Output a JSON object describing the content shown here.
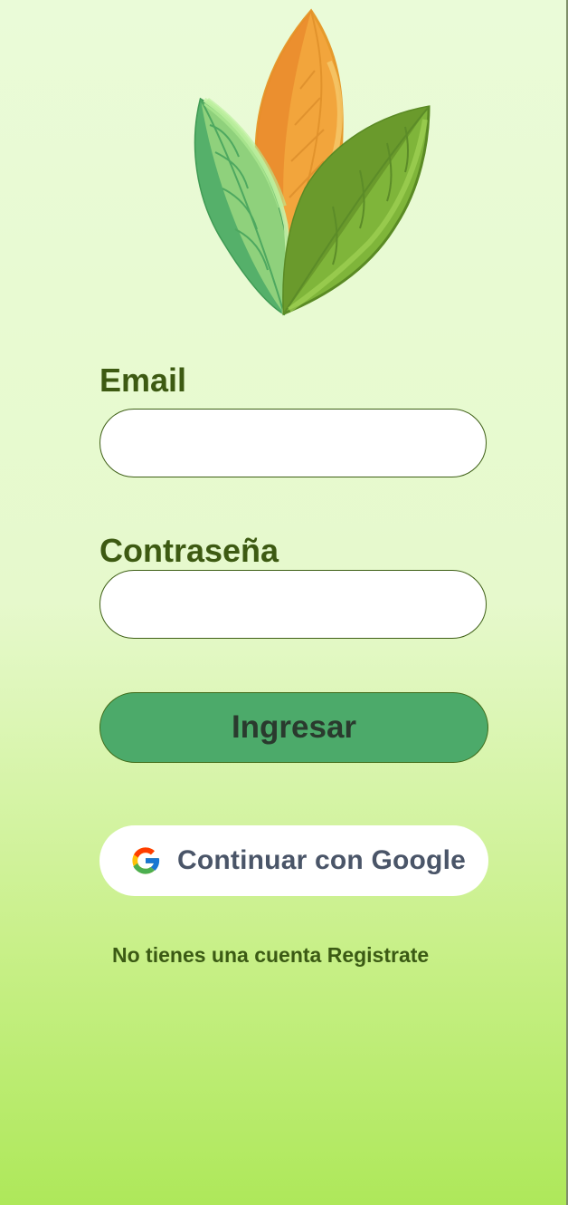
{
  "form": {
    "email_label": "Email",
    "email_value": "",
    "password_label": "Contraseña",
    "password_value": "",
    "login_button_label": "Ingresar"
  },
  "google": {
    "label": "Continuar con Google",
    "icon": "google-g-icon"
  },
  "footer": {
    "prompt": "No tienes una cuenta",
    "register_link": "Registrate"
  },
  "logo": {
    "icon": "leaves-logo-icon",
    "colors": {
      "orange": "#f2a53c",
      "light_green": "#8fd17c",
      "dark_green": "#7fb53a"
    }
  },
  "theme": {
    "text_green": "#3d5a12",
    "button_green": "#4caa6a",
    "bg_top": "#eafbd8",
    "bg_bottom": "#aee85a"
  }
}
